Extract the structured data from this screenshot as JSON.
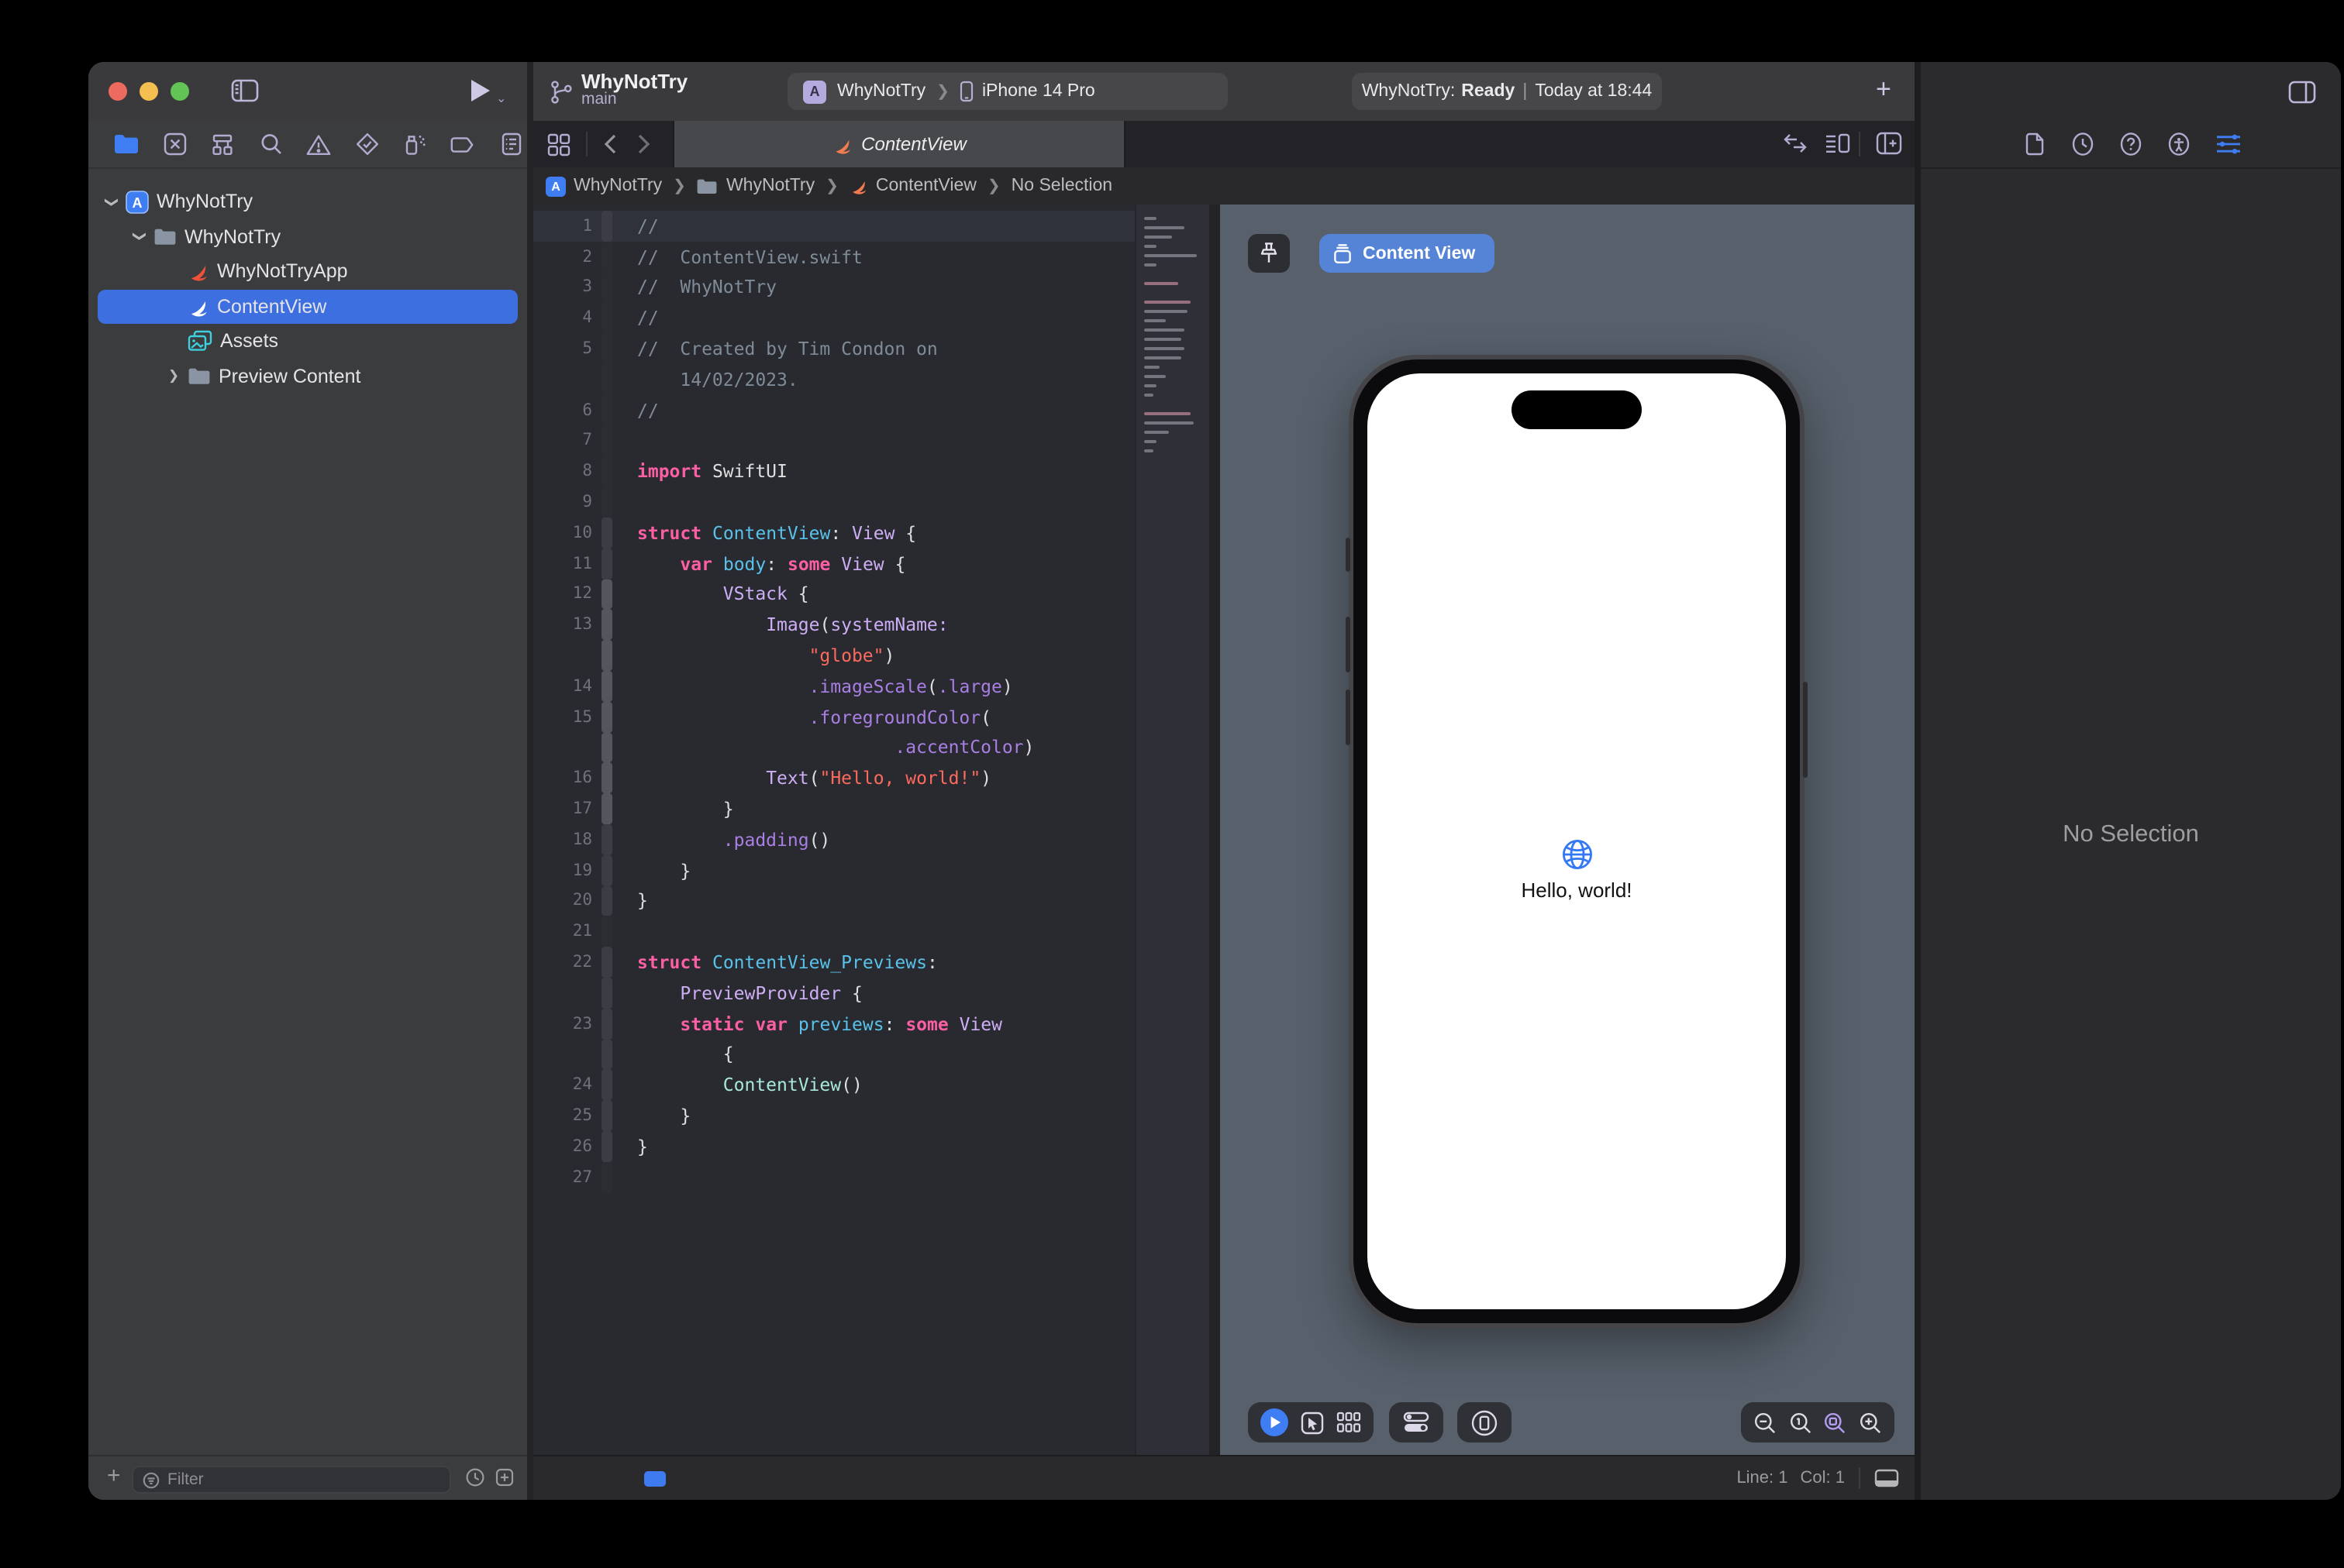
{
  "toolbar": {
    "project_title": "WhyNotTry",
    "branch": "main",
    "scheme": {
      "app": "WhyNotTry",
      "device": "iPhone 14 Pro"
    },
    "status": {
      "prefix": "WhyNotTry:",
      "state": "Ready",
      "divider": "|",
      "time": "Today at 18:44"
    }
  },
  "navigator": {
    "tools": [
      "project-navigator",
      "source-control-navigator",
      "symbol-navigator",
      "find-navigator",
      "issue-navigator",
      "test-navigator",
      "debug-navigator",
      "breakpoint-navigator",
      "report-navigator"
    ],
    "tree": [
      {
        "label": "WhyNotTry",
        "icon": "app",
        "level": 0,
        "disclosure": "open",
        "selected": false
      },
      {
        "label": "WhyNotTry",
        "icon": "folder",
        "level": 1,
        "disclosure": "open",
        "selected": false
      },
      {
        "label": "WhyNotTryApp",
        "icon": "swift-orange",
        "level": 2,
        "disclosure": "none",
        "selected": false
      },
      {
        "label": "ContentView",
        "icon": "swift-white",
        "level": 2,
        "disclosure": "none",
        "selected": true
      },
      {
        "label": "Assets",
        "icon": "assets",
        "level": 2,
        "disclosure": "none",
        "selected": false
      },
      {
        "label": "Preview Content",
        "icon": "folder",
        "level": 2,
        "disclosure": "closed",
        "selected": false
      }
    ],
    "filter_placeholder": "Filter"
  },
  "editor": {
    "tab_label": "ContentView",
    "breadcrumb": [
      {
        "label": "WhyNotTry"
      },
      {
        "label": "WhyNotTry"
      },
      {
        "label": "ContentView"
      },
      {
        "label": "No Selection"
      }
    ],
    "status": {
      "line": "Line: 1",
      "col": "Col: 1"
    }
  },
  "code": {
    "rows": [
      {
        "n": "1",
        "hl": true,
        "bar": 1,
        "s": [
          [
            "//",
            "c"
          ]
        ]
      },
      {
        "n": "2",
        "s": [
          [
            "//  ContentView.swift",
            "c"
          ]
        ]
      },
      {
        "n": "3",
        "s": [
          [
            "//  WhyNotTry",
            "c"
          ]
        ]
      },
      {
        "n": "4",
        "s": [
          [
            "//",
            "c"
          ]
        ]
      },
      {
        "n": "5",
        "s": [
          [
            "//  Created by Tim Condon on",
            "c"
          ]
        ]
      },
      {
        "n": "",
        "s": [
          [
            "    14/02/2023.",
            "c"
          ]
        ]
      },
      {
        "n": "6",
        "s": [
          [
            "//",
            "c"
          ]
        ]
      },
      {
        "n": "7",
        "s": []
      },
      {
        "n": "8",
        "s": [
          [
            "import",
            "k"
          ],
          [
            " SwiftUI",
            "p"
          ]
        ]
      },
      {
        "n": "9",
        "s": []
      },
      {
        "n": "10",
        "bar": 1,
        "s": [
          [
            "struct",
            "k"
          ],
          [
            " ",
            "p"
          ],
          [
            "ContentView",
            "d"
          ],
          [
            ": ",
            "p"
          ],
          [
            "View",
            "t"
          ],
          [
            " {",
            "p"
          ]
        ]
      },
      {
        "n": "11",
        "bar": 1,
        "s": [
          [
            "    ",
            "p"
          ],
          [
            "var",
            "k"
          ],
          [
            " ",
            "p"
          ],
          [
            "body",
            "d"
          ],
          [
            ": ",
            "p"
          ],
          [
            "some",
            "k"
          ],
          [
            " ",
            "p"
          ],
          [
            "View",
            "t"
          ],
          [
            " {",
            "p"
          ]
        ]
      },
      {
        "n": "12",
        "bar": 2,
        "s": [
          [
            "        ",
            "p"
          ],
          [
            "VStack",
            "t"
          ],
          [
            " {",
            "p"
          ]
        ]
      },
      {
        "n": "13",
        "bar": 2,
        "s": [
          [
            "            ",
            "p"
          ],
          [
            "Image",
            "t"
          ],
          [
            "(",
            "p"
          ],
          [
            "systemName:",
            "t"
          ]
        ]
      },
      {
        "n": "",
        "bar": 2,
        "s": [
          [
            "                ",
            "p"
          ],
          [
            "\"globe\"",
            "s"
          ],
          [
            ")",
            "p"
          ]
        ]
      },
      {
        "n": "14",
        "bar": 2,
        "s": [
          [
            "                ",
            "p"
          ],
          [
            ".imageScale",
            "m"
          ],
          [
            "(",
            "p"
          ],
          [
            ".large",
            "m"
          ],
          [
            ")",
            "p"
          ]
        ]
      },
      {
        "n": "15",
        "bar": 2,
        "s": [
          [
            "                ",
            "p"
          ],
          [
            ".foregroundColor",
            "m"
          ],
          [
            "(",
            "p"
          ]
        ]
      },
      {
        "n": "",
        "bar": 2,
        "s": [
          [
            "                        ",
            "p"
          ],
          [
            ".accentColor",
            "m"
          ],
          [
            ")",
            "p"
          ]
        ]
      },
      {
        "n": "16",
        "bar": 2,
        "s": [
          [
            "            ",
            "p"
          ],
          [
            "Text",
            "t"
          ],
          [
            "(",
            "p"
          ],
          [
            "\"Hello, world!\"",
            "s"
          ],
          [
            ")",
            "p"
          ]
        ]
      },
      {
        "n": "17",
        "bar": 2,
        "s": [
          [
            "        }",
            "p"
          ]
        ]
      },
      {
        "n": "18",
        "bar": 1,
        "s": [
          [
            "        ",
            "p"
          ],
          [
            ".padding",
            "m"
          ],
          [
            "()",
            "p"
          ]
        ]
      },
      {
        "n": "19",
        "bar": 1,
        "s": [
          [
            "    }",
            "p"
          ]
        ]
      },
      {
        "n": "20",
        "bar": 1,
        "s": [
          [
            "}",
            "p"
          ]
        ]
      },
      {
        "n": "21",
        "s": []
      },
      {
        "n": "22",
        "bar": 1,
        "s": [
          [
            "struct",
            "k"
          ],
          [
            " ",
            "p"
          ],
          [
            "ContentView_Previews",
            "d"
          ],
          [
            ":",
            "p"
          ]
        ]
      },
      {
        "n": "",
        "bar": 1,
        "s": [
          [
            "    ",
            "p"
          ],
          [
            "PreviewProvider",
            "t"
          ],
          [
            " {",
            "p"
          ]
        ]
      },
      {
        "n": "23",
        "bar": 1,
        "s": [
          [
            "    ",
            "p"
          ],
          [
            "static",
            "k"
          ],
          [
            " ",
            "p"
          ],
          [
            "var",
            "k"
          ],
          [
            " ",
            "p"
          ],
          [
            "previews",
            "d"
          ],
          [
            ": ",
            "p"
          ],
          [
            "some",
            "k"
          ],
          [
            " ",
            "p"
          ],
          [
            "View",
            "t"
          ]
        ]
      },
      {
        "n": "",
        "bar": 1,
        "s": [
          [
            "        {",
            "p"
          ]
        ]
      },
      {
        "n": "24",
        "bar": 1,
        "s": [
          [
            "        ",
            "p"
          ],
          [
            "ContentView",
            "r"
          ],
          [
            "()",
            "p"
          ]
        ]
      },
      {
        "n": "25",
        "bar": 1,
        "s": [
          [
            "    }",
            "p"
          ]
        ]
      },
      {
        "n": "26",
        "bar": 1,
        "s": [
          [
            "}",
            "p"
          ]
        ]
      },
      {
        "n": "27",
        "s": []
      }
    ]
  },
  "canvas": {
    "pill_label": "Content View",
    "phone": {
      "greeting": "Hello, world!"
    }
  },
  "inspector": {
    "empty_message": "No Selection"
  },
  "colors": {
    "accent_blue": "#3f7ef2",
    "selection_blue": "#3d6fe0",
    "swift_orange": "#f05138",
    "keyword_pink": "#fc5fa3",
    "string_red": "#fc6a5d",
    "comment_gray": "#7f8c98",
    "type_purple": "#cdaef5",
    "declaration_cyan": "#58c2ea",
    "project_ref_mint": "#a7e8d9",
    "canvas_background": "#57606b"
  }
}
